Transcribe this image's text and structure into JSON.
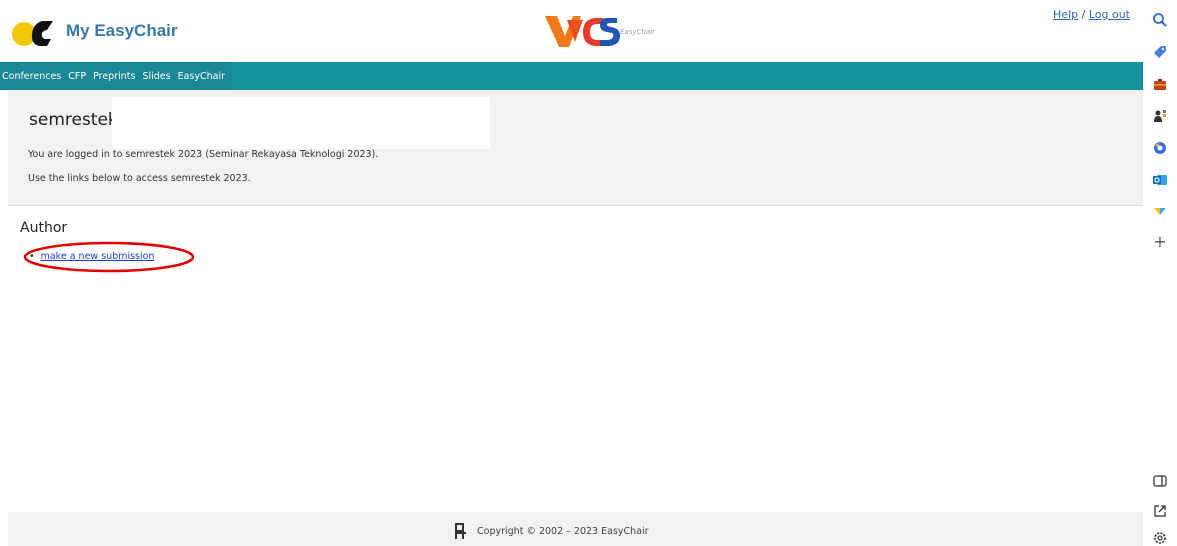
{
  "header": {
    "brand": "My EasyChair",
    "vcs_tagline": "EasyChair",
    "help_label": "Help",
    "separator": "/",
    "logout_label": "Log out"
  },
  "nav": {
    "items": [
      "Conferences",
      "CFP",
      "Preprints",
      "Slides",
      "EasyChair"
    ]
  },
  "conference": {
    "title": "semrestek",
    "logged_in_text": "You are logged in to semrestek 2023 (Seminar Rekayasa Teknologi 2023).",
    "use_links_text": "Use the links below to access semrestek 2023."
  },
  "author": {
    "heading": "Author",
    "bullet": "•",
    "new_submission": "make a new submission"
  },
  "footer": {
    "copyright": "Copyright © 2002 – 2023 EasyChair"
  },
  "sidebar_icons": [
    "search-icon",
    "tag-icon",
    "toolbox-icon",
    "people-icon",
    "copilot-icon",
    "outlook-icon",
    "drop-icon",
    "plus-icon",
    "panel-icon",
    "external-link-icon",
    "settings-icon"
  ],
  "sidebar": {
    "plus": "+"
  },
  "colors": {
    "teal": "#13939f",
    "brand_blue": "#3a78a8",
    "link_blue": "#1a3fd6",
    "annotation_red": "#e00000"
  }
}
